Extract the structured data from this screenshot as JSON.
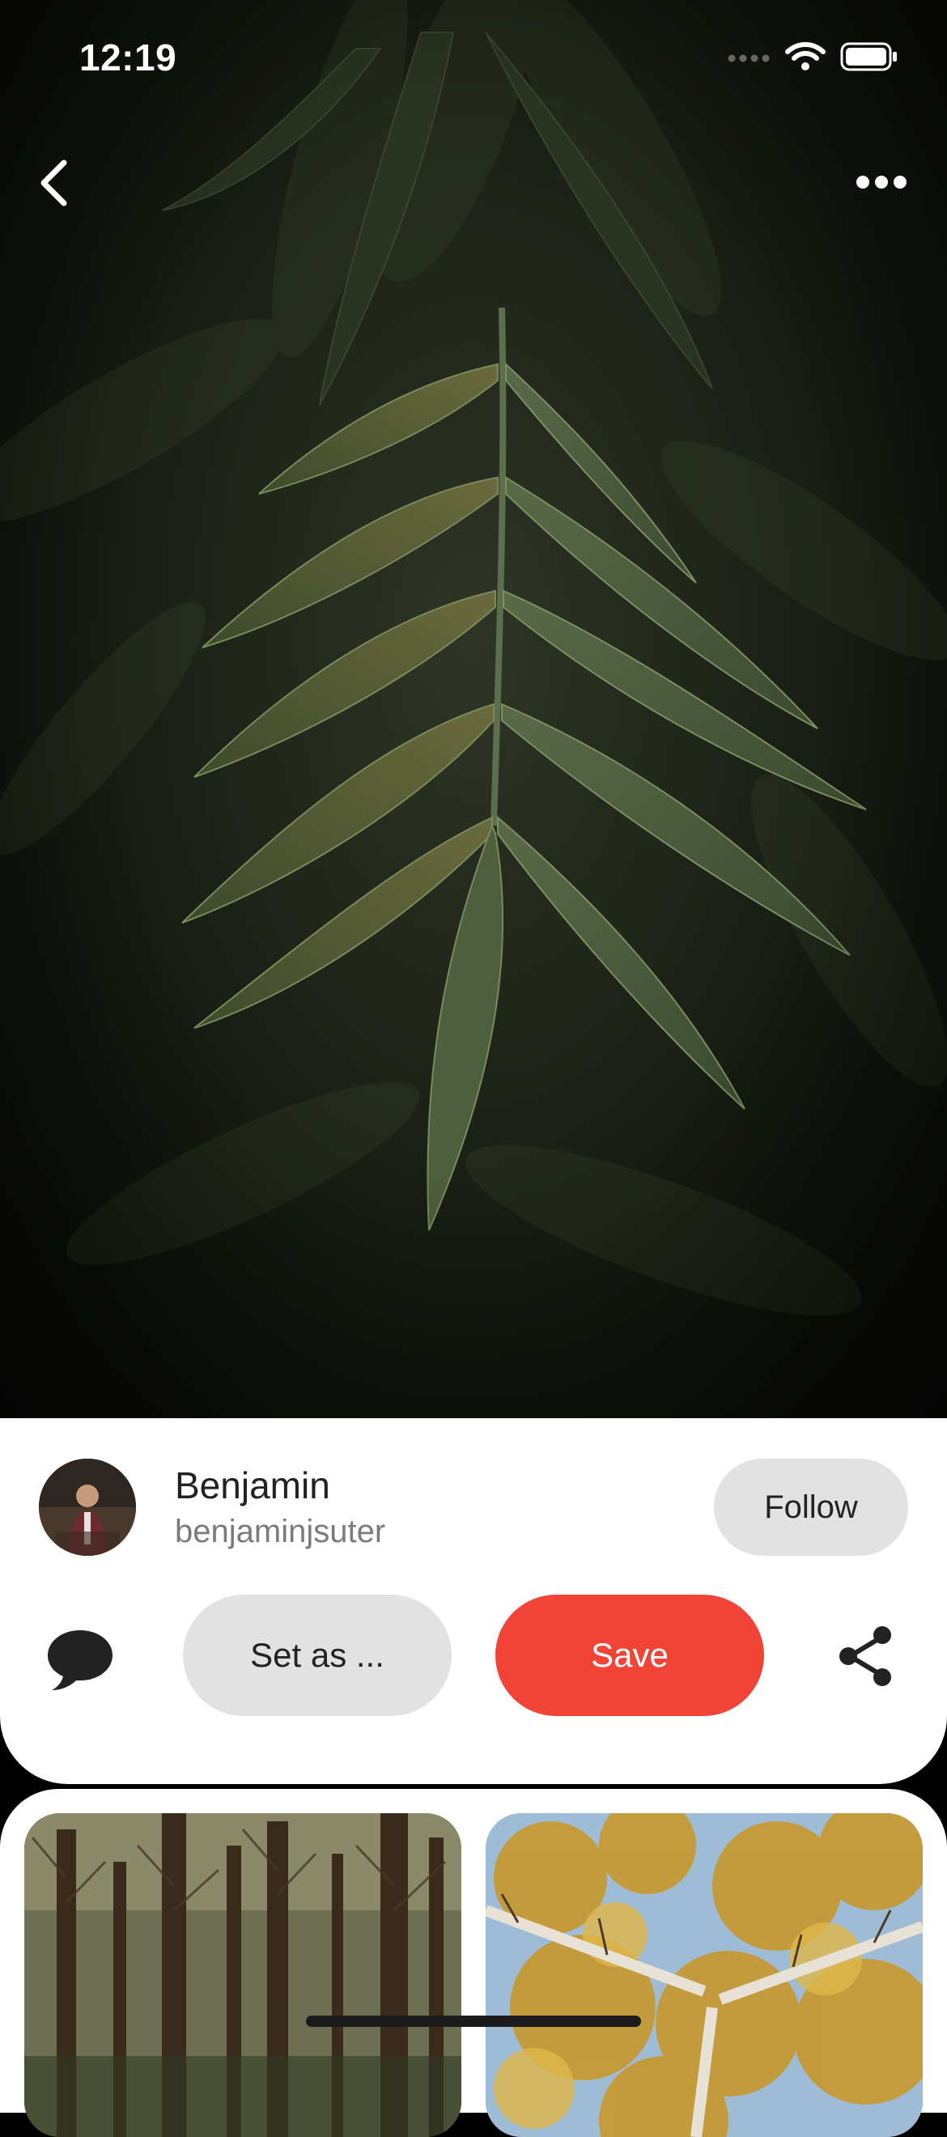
{
  "status_bar": {
    "time": "12:19"
  },
  "hero": {
    "description_icon": "photo-leaves"
  },
  "nav": {
    "back_icon": "chevron-left-icon",
    "more_icon": "more-horizontal-icon"
  },
  "author": {
    "name": "Benjamin",
    "handle": "benjaminjsuter",
    "follow_label": "Follow"
  },
  "actions": {
    "comment_icon": "speech-bubble-icon",
    "set_as_label": "Set as ...",
    "save_label": "Save",
    "share_icon": "share-icon"
  },
  "colors": {
    "save_bg": "#f14336",
    "neutral_btn_bg": "#e2e2e2",
    "card_bg": "#ffffff",
    "screen_bg": "#000000"
  }
}
